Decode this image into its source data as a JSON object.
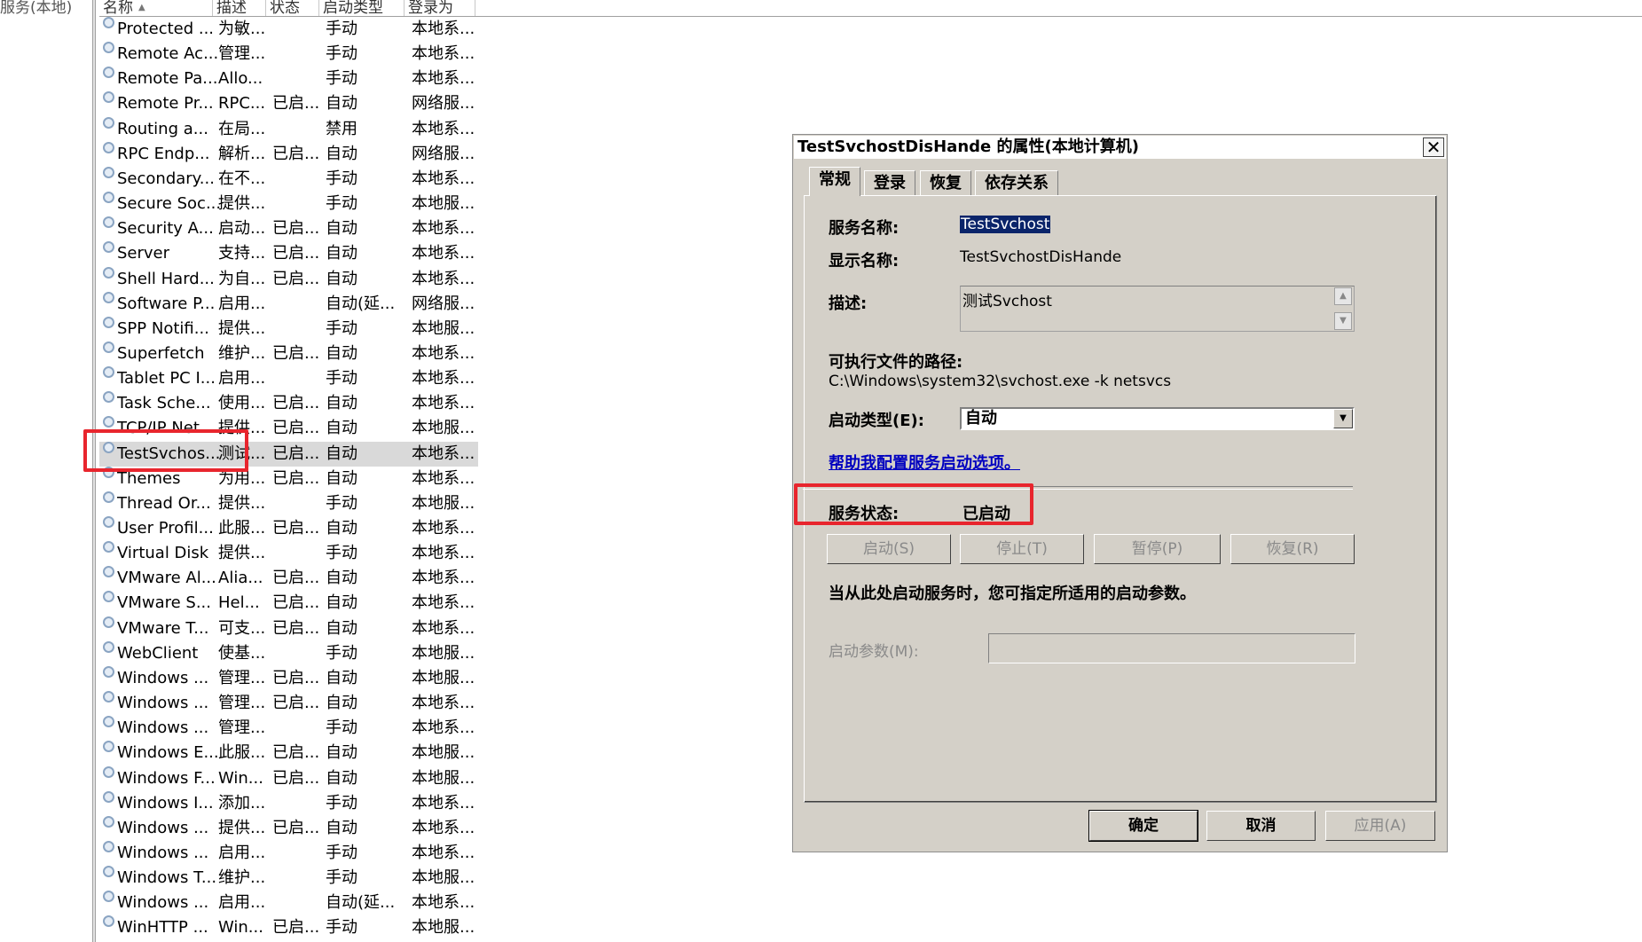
{
  "tree": {
    "label": "服务(本地)"
  },
  "list": {
    "columns": [
      {
        "label": "名称"
      },
      {
        "label": "描述"
      },
      {
        "label": "状态"
      },
      {
        "label": "启动类型"
      },
      {
        "label": "登录为"
      }
    ],
    "rows": [
      {
        "name": "Protected ...",
        "desc": "为敏...",
        "status": "",
        "type": "手动",
        "logon": "本地系..."
      },
      {
        "name": "Remote Ac...",
        "desc": "管理...",
        "status": "",
        "type": "手动",
        "logon": "本地系..."
      },
      {
        "name": "Remote Pa...",
        "desc": "Allo...",
        "status": "",
        "type": "手动",
        "logon": "本地系..."
      },
      {
        "name": "Remote Pr...",
        "desc": "RPC...",
        "status": "已启...",
        "type": "自动",
        "logon": "网络服..."
      },
      {
        "name": "Routing a...",
        "desc": "在局...",
        "status": "",
        "type": "禁用",
        "logon": "本地系..."
      },
      {
        "name": "RPC Endp...",
        "desc": "解析...",
        "status": "已启...",
        "type": "自动",
        "logon": "网络服..."
      },
      {
        "name": "Secondary...",
        "desc": "在不...",
        "status": "",
        "type": "手动",
        "logon": "本地系..."
      },
      {
        "name": "Secure Soc...",
        "desc": "提供...",
        "status": "",
        "type": "手动",
        "logon": "本地服..."
      },
      {
        "name": "Security A...",
        "desc": "启动...",
        "status": "已启...",
        "type": "自动",
        "logon": "本地系..."
      },
      {
        "name": "Server",
        "desc": "支持...",
        "status": "已启...",
        "type": "自动",
        "logon": "本地系..."
      },
      {
        "name": "Shell Hard...",
        "desc": "为自...",
        "status": "已启...",
        "type": "自动",
        "logon": "本地系..."
      },
      {
        "name": "Software P...",
        "desc": "启用...",
        "status": "",
        "type": "自动(延...",
        "logon": "网络服..."
      },
      {
        "name": "SPP Notifi...",
        "desc": "提供...",
        "status": "",
        "type": "手动",
        "logon": "本地服..."
      },
      {
        "name": "Superfetch",
        "desc": "维护...",
        "status": "已启...",
        "type": "自动",
        "logon": "本地系..."
      },
      {
        "name": "Tablet PC I...",
        "desc": "启用...",
        "status": "",
        "type": "手动",
        "logon": "本地系..."
      },
      {
        "name": "Task Sche...",
        "desc": "使用...",
        "status": "已启...",
        "type": "自动",
        "logon": "本地系..."
      },
      {
        "name": "TCP/IP Net...",
        "desc": "提供...",
        "status": "已启...",
        "type": "自动",
        "logon": "本地服..."
      },
      {
        "name": "TestSvchos...",
        "desc": "测试...",
        "status": "已启...",
        "type": "自动",
        "logon": "本地系..."
      },
      {
        "name": "Themes",
        "desc": "为用...",
        "status": "已启...",
        "type": "自动",
        "logon": "本地系..."
      },
      {
        "name": "Thread Or...",
        "desc": "提供...",
        "status": "",
        "type": "手动",
        "logon": "本地服..."
      },
      {
        "name": "User Profil...",
        "desc": "此服...",
        "status": "已启...",
        "type": "自动",
        "logon": "本地系..."
      },
      {
        "name": "Virtual Disk",
        "desc": "提供...",
        "status": "",
        "type": "手动",
        "logon": "本地系..."
      },
      {
        "name": "VMware Al...",
        "desc": "Alia...",
        "status": "已启...",
        "type": "自动",
        "logon": "本地系..."
      },
      {
        "name": "VMware S...",
        "desc": "Hel...",
        "status": "已启...",
        "type": "自动",
        "logon": "本地系..."
      },
      {
        "name": "VMware T...",
        "desc": "可支...",
        "status": "已启...",
        "type": "自动",
        "logon": "本地系..."
      },
      {
        "name": "WebClient",
        "desc": "使基...",
        "status": "",
        "type": "手动",
        "logon": "本地服..."
      },
      {
        "name": "Windows ...",
        "desc": "管理...",
        "status": "已启...",
        "type": "自动",
        "logon": "本地服..."
      },
      {
        "name": "Windows ...",
        "desc": "管理...",
        "status": "已启...",
        "type": "自动",
        "logon": "本地系..."
      },
      {
        "name": "Windows ...",
        "desc": "管理...",
        "status": "",
        "type": "手动",
        "logon": "本地系..."
      },
      {
        "name": "Windows E...",
        "desc": "此服...",
        "status": "已启...",
        "type": "自动",
        "logon": "本地服..."
      },
      {
        "name": "Windows F...",
        "desc": "Win...",
        "status": "已启...",
        "type": "自动",
        "logon": "本地服..."
      },
      {
        "name": "Windows I...",
        "desc": "添加...",
        "status": "",
        "type": "手动",
        "logon": "本地系..."
      },
      {
        "name": "Windows ...",
        "desc": "提供...",
        "status": "已启...",
        "type": "自动",
        "logon": "本地系..."
      },
      {
        "name": "Windows ...",
        "desc": "启用...",
        "status": "",
        "type": "手动",
        "logon": "本地系..."
      },
      {
        "name": "Windows T...",
        "desc": "维护...",
        "status": "",
        "type": "手动",
        "logon": "本地服..."
      },
      {
        "name": "Windows ...",
        "desc": "启用...",
        "status": "",
        "type": "自动(延...",
        "logon": "本地系..."
      },
      {
        "name": "WinHTTP ...",
        "desc": "Win...",
        "status": "已启...",
        "type": "手动",
        "logon": "本地服..."
      }
    ]
  },
  "dialog": {
    "title": "TestSvchostDisHande 的属性(本地计算机)",
    "close_glyph": "✕",
    "tabs": [
      "常规",
      "登录",
      "恢复",
      "依存关系"
    ],
    "service_name_label": "服务名称:",
    "service_name": "TestSvchost",
    "display_name_label": "显示名称:",
    "display_name": "TestSvchostDisHande",
    "description_label": "描述:",
    "description": "测试Svchost",
    "path_label": "可执行文件的路径:",
    "path": "C:\\Windows\\system32\\svchost.exe -k netsvcs",
    "startup_type_label": "启动类型(E):",
    "startup_type": "自动",
    "help_link": "帮助我配置服务启动选项。",
    "status_label": "服务状态:",
    "status_value": "已启动",
    "buttons": {
      "start": "启动(S)",
      "stop": "停止(T)",
      "pause": "暂停(P)",
      "resume": "恢复(R)"
    },
    "hint": "当从此处启动服务时，您可指定所适用的启动参数。",
    "params_label": "启动参数(M):",
    "ok": "确定",
    "cancel": "取消",
    "apply": "应用(A)"
  },
  "colors": {
    "highlight_box": "#e8252d",
    "selected_row": "#d9d9d9",
    "dialog_bg": "#d4d0c8"
  }
}
